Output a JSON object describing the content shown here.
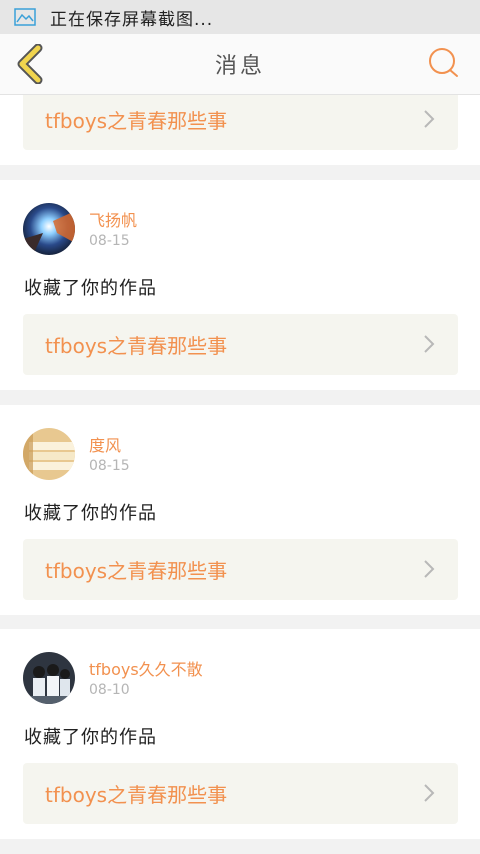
{
  "status_bar": {
    "text": "正在保存屏幕截图..."
  },
  "header": {
    "title": "消息"
  },
  "cards": [
    {
      "link_text": "tfboys之青春那些事"
    },
    {
      "user": "飞扬帆",
      "date": "08-15",
      "message": "收藏了你的作品",
      "link_text": "tfboys之青春那些事"
    },
    {
      "user": "度风",
      "date": "08-15",
      "message": "收藏了你的作品",
      "link_text": "tfboys之青春那些事"
    },
    {
      "user": "tfboys久久不散",
      "date": "08-10",
      "message": "收藏了你的作品",
      "link_text": "tfboys之青春那些事"
    }
  ],
  "colors": {
    "accent": "#f2914f",
    "back_arrow": "#f0d44e",
    "card_link_bg": "#f5f5ef",
    "page_bg": "#f2f2f2"
  },
  "icons": {
    "status": "screenshot-icon",
    "back": "back-arrow-icon",
    "search": "search-icon",
    "chevron": "chevron-right-icon"
  }
}
